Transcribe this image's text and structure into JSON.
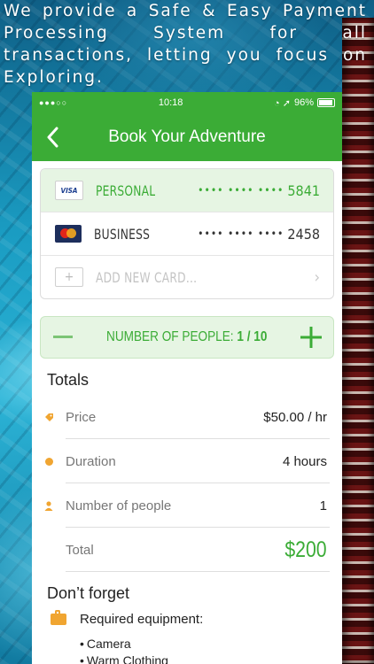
{
  "promo": {
    "headline": "We provide a Safe & Easy Payment Processing System for all transactions, letting you focus on Exploring."
  },
  "status_bar": {
    "signal": "●●●○○",
    "time": "10:18",
    "icons": "◔ ➚",
    "battery": "96%"
  },
  "nav": {
    "back_icon": "chevron-left-icon",
    "title": "Book Your Adventure"
  },
  "cards": [
    {
      "logo": "VISA",
      "label": "PERSONAL",
      "masked": "•••• •••• ••••",
      "last4": "5841",
      "selected": true
    },
    {
      "logo": "mastercard",
      "label": "BUSINESS",
      "masked": "•••• •••• ••••",
      "last4": "2458",
      "selected": false
    },
    {
      "logo": "+",
      "label": "ADD NEW CARD...",
      "chevron": "›"
    }
  ],
  "people": {
    "minus": "—",
    "plus": "+",
    "label": "NUMBER OF PEOPLE:",
    "value": "1 / 10"
  },
  "totals": {
    "title": "Totals",
    "rows": [
      {
        "label": "Price",
        "value": "$50.00 / hr",
        "icon": "tag-icon"
      },
      {
        "label": "Duration",
        "value": "4 hours",
        "icon": "clock-icon"
      },
      {
        "label": "Number of people",
        "value": "1",
        "icon": "person-icon"
      },
      {
        "label": "Total",
        "value": "$200"
      }
    ]
  },
  "reminder": {
    "title": "Don’t forget",
    "equipment_label": "Required equipment:",
    "items": [
      "Camera",
      "Warm Clothing"
    ]
  },
  "colors": {
    "brand_green": "#3bac36",
    "accent_orange": "#f0a531",
    "selected_bg": "#e6f5e3"
  }
}
